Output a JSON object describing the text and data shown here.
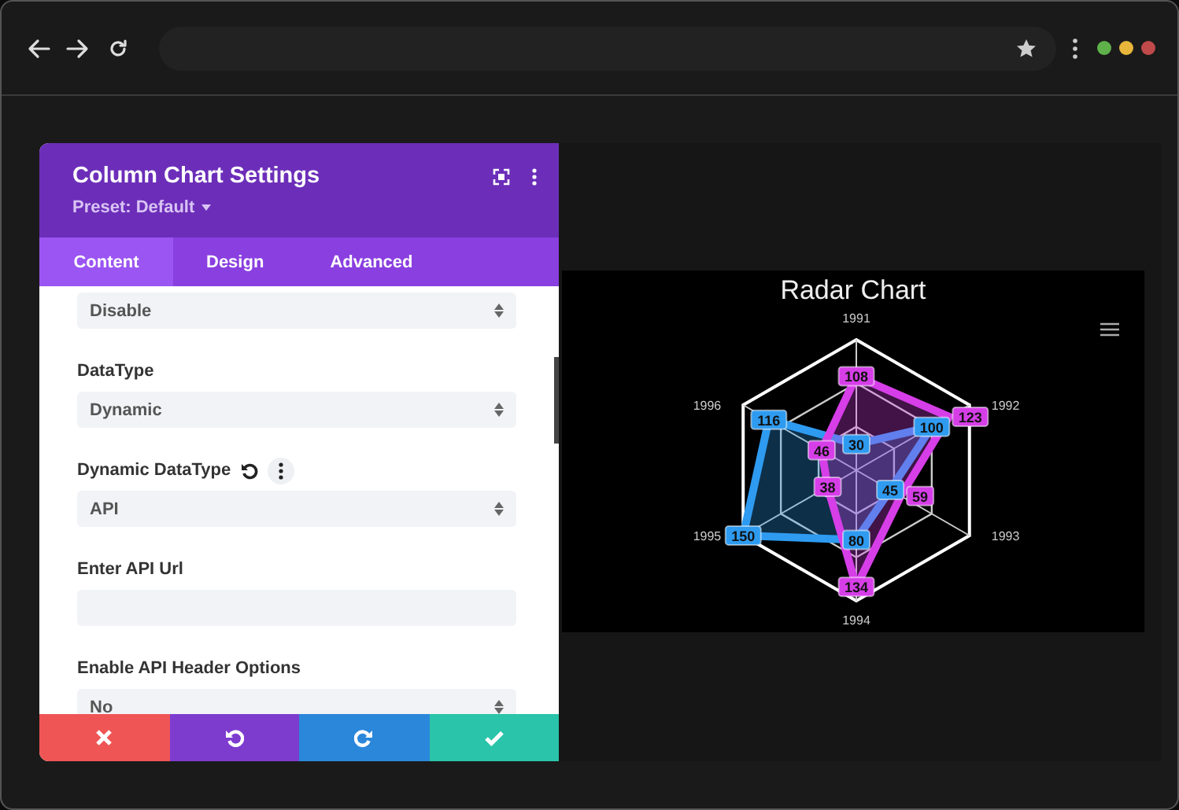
{
  "panel": {
    "title": "Column Chart Settings",
    "preset": "Preset: Default",
    "tabs": [
      {
        "label": "Content",
        "selected": true
      },
      {
        "label": "Design",
        "selected": false
      },
      {
        "label": "Advanced",
        "selected": false
      }
    ],
    "fields": [
      {
        "kind": "select",
        "value": "Disable"
      },
      {
        "kind": "select",
        "label": "DataType",
        "value": "Dynamic"
      },
      {
        "kind": "select",
        "label": "Dynamic DataType",
        "value": "API",
        "actions": true
      },
      {
        "kind": "text",
        "label": "Enter API Url"
      },
      {
        "kind": "select",
        "label": "Enable API Header Options",
        "value": "No"
      }
    ],
    "footer": [
      {
        "kind": "cancel"
      },
      {
        "kind": "undo"
      },
      {
        "kind": "redo"
      },
      {
        "kind": "save"
      }
    ]
  },
  "preview": {
    "radar": {
      "title": "Radar Chart",
      "axes": [
        "1991",
        "1992",
        "1993",
        "1994",
        "1995",
        "1996"
      ],
      "series": [
        {
          "color": "#2e9bf0",
          "labels": [
            "30",
            "100",
            "45",
            "80",
            "150",
            "116"
          ]
        },
        {
          "color": "#d63ee8",
          "labels": [
            "108",
            "123",
            "59",
            "134",
            "38",
            "46"
          ]
        }
      ]
    }
  }
}
